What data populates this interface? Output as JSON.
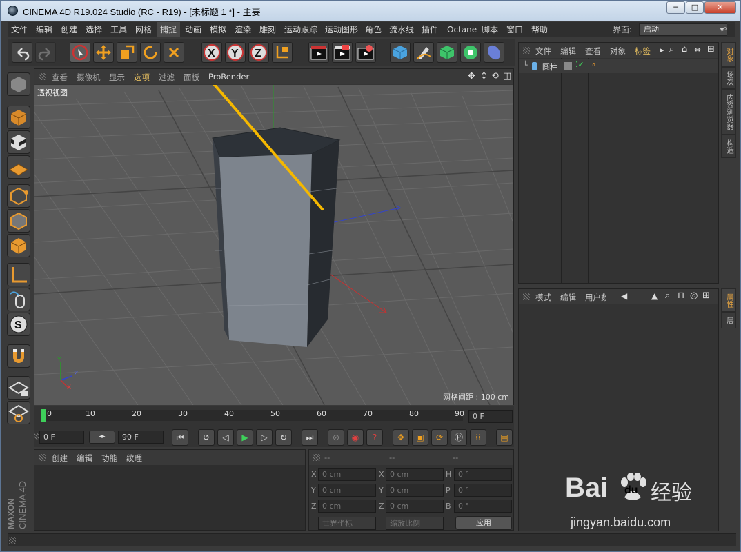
{
  "window": {
    "title": "CINEMA 4D R19.024 Studio (RC - R19) - [未标题 1 *] - 主要",
    "min_glyph": "─",
    "max_glyph": "□",
    "close_glyph": "✕"
  },
  "menu": {
    "items": [
      "文件",
      "编辑",
      "创建",
      "选择",
      "工具",
      "网格",
      "捕捉",
      "动画",
      "模拟",
      "渲染",
      "雕刻",
      "运动跟踪",
      "运动图形",
      "角色",
      "流水线",
      "插件",
      "Octane",
      "脚本",
      "窗口",
      "帮助"
    ],
    "layout_label": "界面:",
    "layout_value": "启动"
  },
  "viewport": {
    "menu": [
      "查看",
      "摄像机",
      "显示",
      "选项",
      "过滤",
      "面板",
      "ProRender"
    ],
    "name": "透视视图",
    "grid_label": "网格间距 : 100 cm",
    "axis_x": "X",
    "axis_y": "Y",
    "axis_z": "Z"
  },
  "timeline": {
    "ticks": [
      "0",
      "10",
      "20",
      "30",
      "40",
      "50",
      "60",
      "70",
      "80",
      "90"
    ],
    "current_frame": "0 F"
  },
  "transport": {
    "start_frame": "0 F",
    "end_frame": "90 F"
  },
  "materials": {
    "menu": [
      "创建",
      "编辑",
      "功能",
      "纹理"
    ]
  },
  "coords": {
    "header": [
      "--",
      "--",
      "--"
    ],
    "rows": [
      {
        "a": "X",
        "av": "0 cm",
        "b": "X",
        "bv": "0 cm",
        "c": "H",
        "cv": "0 °"
      },
      {
        "a": "Y",
        "av": "0 cm",
        "b": "Y",
        "bv": "0 cm",
        "c": "P",
        "cv": "0 °"
      },
      {
        "a": "Z",
        "av": "0 cm",
        "b": "Z",
        "bv": "0 cm",
        "c": "B",
        "cv": "0 °"
      }
    ],
    "world_label": "世界坐标",
    "scale_label": "缩放比例",
    "apply_label": "应用"
  },
  "objects": {
    "menu": [
      "文件",
      "编辑",
      "查看",
      "对象",
      "标签"
    ],
    "item": "圆柱"
  },
  "attributes": {
    "menu": [
      "模式",
      "编辑",
      "用户数"
    ]
  },
  "right_tabs": [
    "对象",
    "场次",
    "内容浏览器",
    "构造"
  ],
  "right_tabs2": [
    "属性",
    "层"
  ],
  "brand": {
    "maxon": "MAXON",
    "product": "CINEMA 4D"
  },
  "watermark": {
    "main": "Bai",
    "du": "du",
    "jy": "经验",
    "url": "jingyan.baidu.com"
  },
  "colors": {
    "accent": "#e8a540",
    "arrow": "#f5b800",
    "axis_red": "#c83030",
    "axis_blue": "#3344cc",
    "axis_green": "#2a9a2a"
  }
}
